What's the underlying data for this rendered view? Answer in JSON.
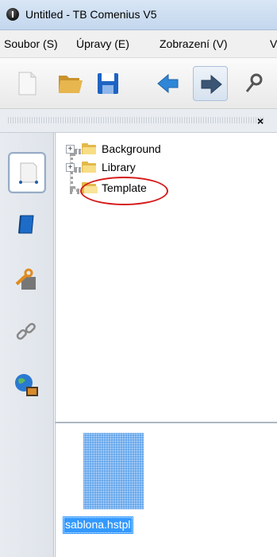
{
  "window": {
    "title": "Untitled - TB Comenius V5"
  },
  "menu": {
    "items": [
      "Soubor (S)",
      "Úpravy (E)",
      "Zobrazení (V)",
      "V"
    ]
  },
  "toolbar": {
    "buttons": [
      "new-document-icon",
      "open-folder-icon",
      "save-icon",
      "back-arrow-icon",
      "forward-arrow-icon",
      "tools-icon"
    ]
  },
  "panel": {
    "close_label": "×"
  },
  "tabs": [
    "template-pages-icon",
    "eraser-book-icon",
    "tools-wrench-icon",
    "link-chain-icon",
    "globe-media-icon"
  ],
  "tree": {
    "nodes": [
      {
        "label": "Background",
        "expandable": true
      },
      {
        "label": "Library",
        "expandable": true
      },
      {
        "label": "Template",
        "expandable": false,
        "highlighted": true
      }
    ]
  },
  "files": {
    "items": [
      {
        "name": "sablona.hstpl",
        "selected": true
      }
    ]
  },
  "colors": {
    "highlight_ellipse": "#d51a1a",
    "selection": "#3399ff",
    "folder": "#e3b94a"
  }
}
